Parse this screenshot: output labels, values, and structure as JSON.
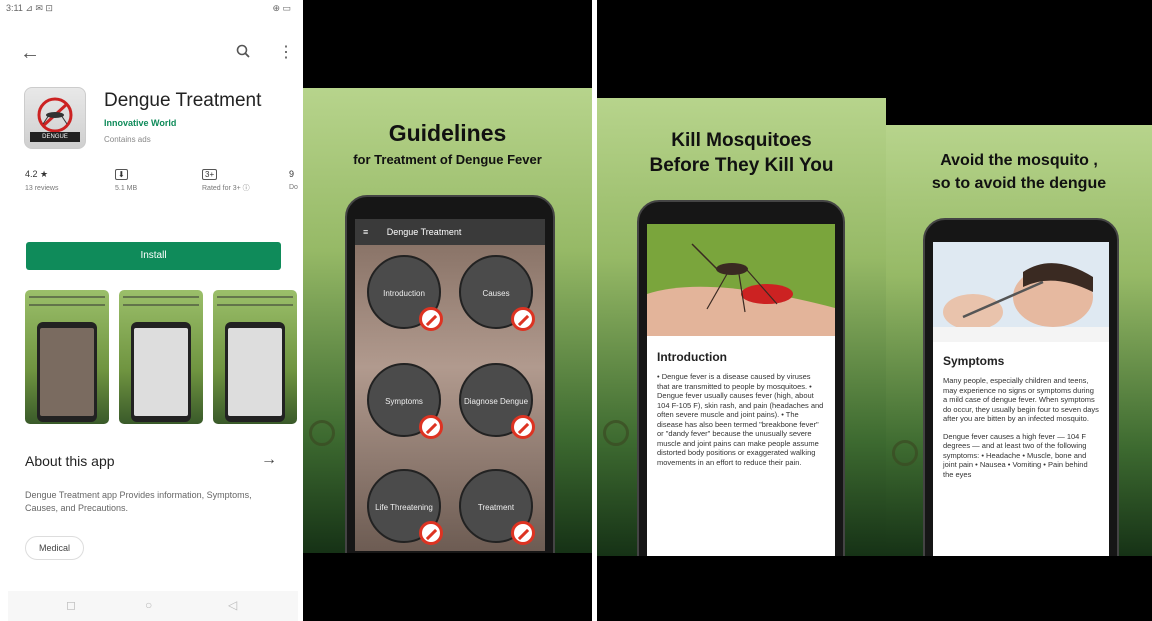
{
  "status_bar": {
    "left": "3:11 ⊿ ✉ ⊡",
    "right": "⊕ ▭"
  },
  "store": {
    "app_name": "Dengue Treatment",
    "developer": "Innovative World",
    "ads": "Contains ads",
    "icon_label": "DENGUE",
    "stats": [
      {
        "top": "4.2 ★",
        "bottom": "13 reviews"
      },
      {
        "top": "⬇",
        "bottom": "5.1 MB"
      },
      {
        "top": "3+",
        "bottom": "Rated for 3+ ⓘ"
      },
      {
        "top": "9",
        "bottom": "Do"
      }
    ],
    "install_label": "Install",
    "about_title": "About this app",
    "about_arrow": "→",
    "description": "Dengue Treatment app Provides information, Symptoms, Causes, and Precautions.",
    "category_chip": "Medical",
    "nav": [
      "◻",
      "○",
      "◁"
    ]
  },
  "promo1": {
    "title": "Guidelines",
    "subtitle": "for Treatment of Dengue Fever",
    "app_header": "Dengue Treatment",
    "menu_icon": "≡",
    "buttons": [
      "Introduction",
      "Causes",
      "Symptoms",
      "Diagnose Dengue",
      "Life Threatening",
      "Treatment"
    ]
  },
  "promo2": {
    "title_line1": "Kill Mosquitoes",
    "title_line2": "Before They Kill You",
    "card_title": "Introduction",
    "card_text": "• Dengue fever is a disease caused by viruses that are transmitted to people by mosquitoes. • Dengue fever usually causes fever (high, about 104 F-105 F), skin rash, and pain (headaches and often severe muscle and joint pains). • The disease has also been termed \"breakbone fever\" or \"dandy fever\" because the unusually severe muscle and joint pains can make people assume distorted body positions or exaggerated walking movements in an effort to reduce their pain."
  },
  "promo3": {
    "title_line1": "Avoid the mosquito ,",
    "title_line2": "so to avoid the dengue",
    "card_title": "Symptoms",
    "card_text1": "Many people, especially children and teens, may experience no signs or symptoms during a mild case of dengue fever. When symptoms do occur, they usually begin four to seven days after you are bitten by an infected mosquito.",
    "card_text2": "Dengue fever causes a high fever — 104 F degrees — and at least two of the following symptoms: • Headache • Muscle, bone and joint pain • Nausea • Vomiting • Pain behind the eyes"
  }
}
